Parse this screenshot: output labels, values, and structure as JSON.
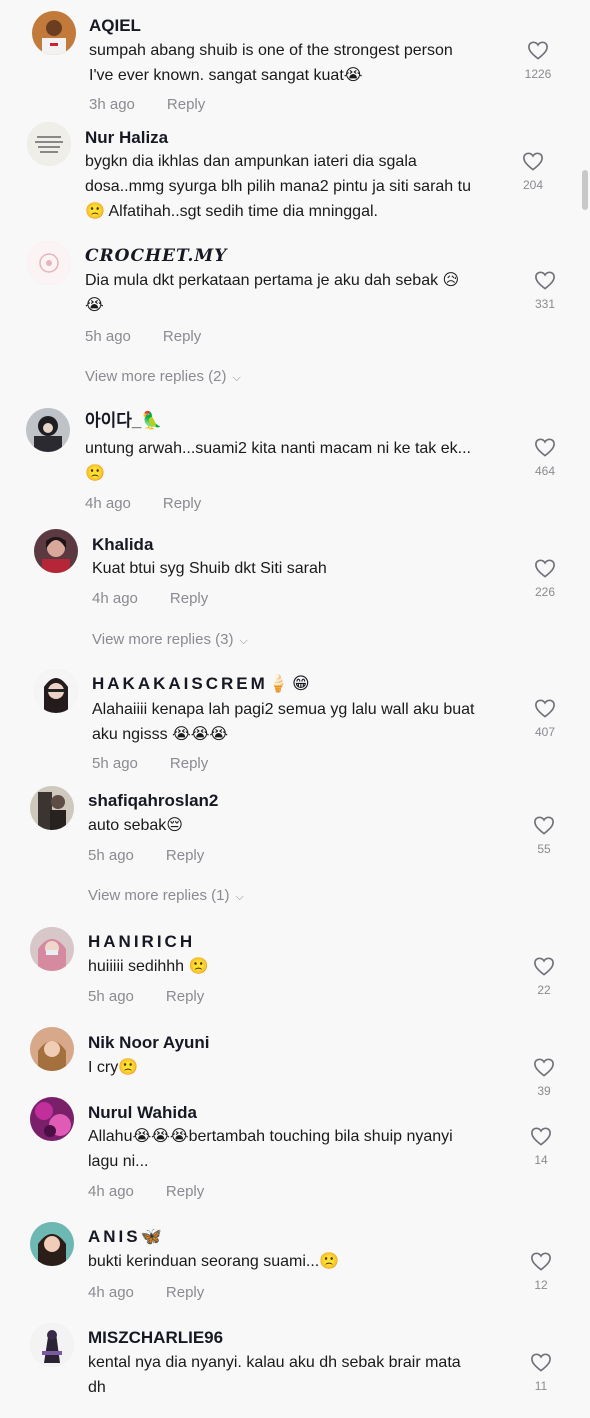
{
  "comments": [
    {
      "username": "AQIEL",
      "text": "sumpah abang shuib is one of the strongest person\nI've ever known. sangat sangat kuat😭",
      "time": "3h ago",
      "reply": "Reply",
      "likes": "1226"
    },
    {
      "username": "Nur Haliza",
      "text": "bygkn dia ikhlas dan ampunkan iateri dia sgala\ndosa..mmg syurga blh pilih mana2 pintu ja siti sarah tu\n🙁 Alfatihah..sgt sedih time dia mninggal.",
      "likes": "204"
    },
    {
      "username": "CROCHET.MY",
      "text": "Dia mula dkt perkataan pertama je aku dah sebak 😥\n😭",
      "time": "5h ago",
      "reply": "Reply",
      "likes": "331",
      "more": "View more replies (2)"
    },
    {
      "username": "아이다_🦜",
      "text": "untung arwah...suami2 kita nanti macam ni ke tak ek...\n🙁",
      "time": "4h ago",
      "reply": "Reply",
      "likes": "464"
    },
    {
      "username": "Khalida",
      "text": "Kuat btui syg Shuib dkt Siti sarah",
      "time": "4h ago",
      "reply": "Reply",
      "likes": "226",
      "more": "View more replies (3)"
    },
    {
      "username": "HAKAKAISCREM🍦😁",
      "text": "Alahaiiii kenapa lah pagi2 semua yg lalu wall aku buat\naku ngisss 😭😭😭",
      "time": "5h ago",
      "reply": "Reply",
      "likes": "407"
    },
    {
      "username": "shafiqahroslan2",
      "text": "auto sebak😔",
      "time": "5h ago",
      "reply": "Reply",
      "likes": "55",
      "more": "View more replies (1)"
    },
    {
      "username": "HANIRICH",
      "text": "huiiiii sedihhh 🙁",
      "time": "5h ago",
      "reply": "Reply",
      "likes": "22"
    },
    {
      "username": "Nik Noor Ayuni",
      "text": "I cry🙁",
      "likes": "39"
    },
    {
      "username": "Nurul Wahida",
      "text": "Allahu😭😭😭bertambah touching bila shuip nyanyi\nlagu ni...",
      "time": "4h ago",
      "reply": "Reply",
      "likes": "14"
    },
    {
      "username": "ANIS🦋",
      "text": "bukti kerinduan seorang suami...🙁",
      "time": "4h ago",
      "reply": "Reply",
      "likes": "12"
    },
    {
      "username": "MISZCHARLIE96",
      "text": "kental nya dia nyanyi. kalau aku dh sebak brair mata\ndh",
      "likes": "11"
    }
  ],
  "icons": {
    "like": "heart-outline-icon",
    "chevron": "chevron-down-icon"
  },
  "colors": {
    "text": "#161823",
    "muted": "#8a8b91",
    "background": "#f8f8f8"
  }
}
